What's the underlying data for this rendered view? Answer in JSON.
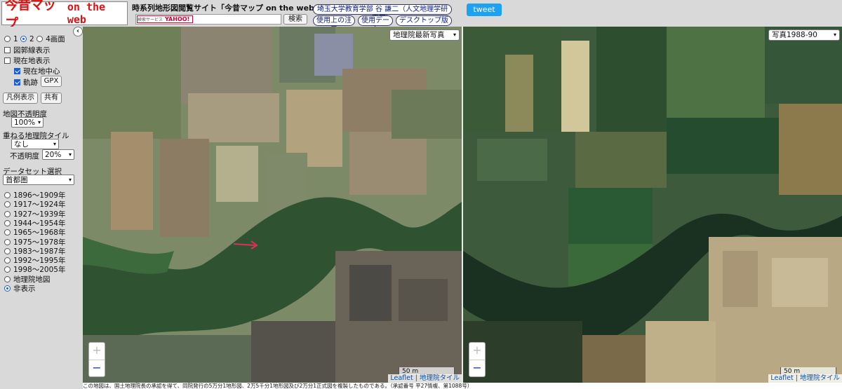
{
  "header": {
    "logo_jp": "今昔マップ",
    "logo_en": "on the web",
    "site_title": "時系列地形図閲覧サイト「今昔マップ on the web」",
    "yahoo_badge_prefix": "検索サービス",
    "yahoo_badge_brand": "YAHOO!",
    "search_value": "",
    "search_button": "検索",
    "author_link": "埼玉大学教育学部 谷 謙二（人文地理学研究室）",
    "usage_notes_link": "使用上の注意",
    "data_used_link": "使用データ",
    "desktop_link": "デスクトップ版",
    "tweet_label": "tweet"
  },
  "sidebar": {
    "screen_options": [
      "1",
      "2",
      "4画面"
    ],
    "screen_selected": "2",
    "graticule_label": "図郭線表示",
    "current_map_label": "現在地表示",
    "center_label": "現在地中心",
    "track_label": "軌跡",
    "gpx_button": "GPX",
    "legend_button": "凡例表示",
    "share_button": "共有",
    "opacity_label": "地図不透明度",
    "opacity_value": "100%",
    "overlay_label": "重ねる地理院タイル",
    "overlay_value": "なし",
    "overlay_opacity_label": "不透明度",
    "overlay_opacity_value": "20%",
    "dataset_label": "データセット選択",
    "dataset_value": "首都圏",
    "periods": [
      "1896～1909年",
      "1917～1924年",
      "1927～1939年",
      "1944～1954年",
      "1965～1968年",
      "1975～1978年",
      "1983～1987年",
      "1992～1995年",
      "1998～2005年",
      "地理院地図",
      "非表示"
    ],
    "period_selected": "非表示",
    "collapse_icon": "chevron-left-icon"
  },
  "map_left": {
    "layer_select": "地理院最新写真",
    "zoom_in": "+",
    "zoom_out": "−",
    "scale": "50 m",
    "attribution_leaflet": "Leaflet",
    "attribution_tiles": "地理院タイル"
  },
  "map_right": {
    "layer_select": "写真1988-90",
    "zoom_in": "+",
    "zoom_out": "−",
    "scale": "50 m",
    "attribution_leaflet": "Leaflet",
    "attribution_tiles": "地理院タイル"
  },
  "footer": {
    "note": "この地図は、国土地理院長の承認を得て、同院発行の5万分1地形図、2万5千分1地形図及び2万分1正式図を複製したものである。（承認番号 平27情複、第1088号）"
  }
}
